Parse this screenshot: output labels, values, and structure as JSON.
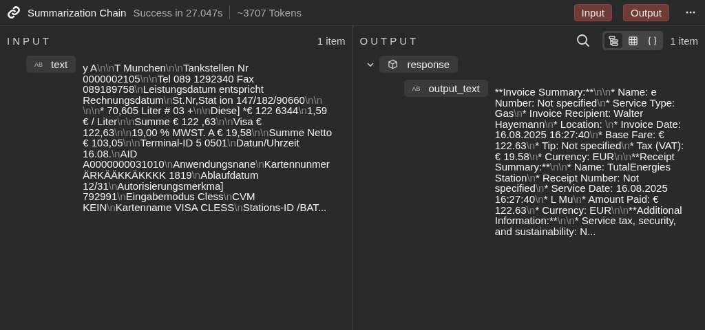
{
  "header": {
    "title": "Summarization Chain",
    "status": "Success in 27.047s",
    "tokens": "~3707 Tokens",
    "buttons": [
      {
        "label": "Input"
      },
      {
        "label": "Output"
      }
    ]
  },
  "input": {
    "title": "INPUT",
    "count": "1 item",
    "fields": [
      {
        "type_badge": "AB",
        "name": "text",
        "value": "y A\\n\\nT Munchen\\n\\nTankstellen Nr 0000002105\\n\\nTel 089 1292340 Fax 089189758\\nLeistungsdatum entspricht Rechnungsdatum\\nSt.Nr,Stat ion 147/182/90660\\n\\n \\n\\n* 70,605 Liter # 03 +\\n\\nDiese] *€ 122 6344\\n1,59 € / Liter\\n\\nSumme € 122 ,63\\n\\nVisa € 122,63\\n\\n19,00 % MWST. A € 19,58\\n\\nSumme Netto € 103,05\\n\\nTerminal-ID 5 0501\\nDatun/Uhrzeit 16.08.\\nAID A0000000031010\\nAnwendungsnane\\nKartennunmer ÄRKÄÄKKÄKKKK 1819\\nAblaufdatum 12/31\\nAutorisierungsmerkma] 792991\\nEingabemodus Cless\\nCVM KEIN\\nKartenname VISA CLESS\\nStations-ID /BAT..."
      }
    ]
  },
  "output": {
    "title": "OUTPUT",
    "count": "1 item",
    "views": [
      {
        "kind": "schema",
        "selected": true
      },
      {
        "kind": "table",
        "selected": false
      },
      {
        "kind": "json",
        "selected": false
      }
    ],
    "tree": {
      "name": "response",
      "expanded": true,
      "children": [
        {
          "type_badge": "AB",
          "name": "output_text",
          "value": "**Invoice Summary:**\\n\\n* Name: e Number: Not specified\\n* Service Type: Gas\\n* Invoice Recipient: Walter Hayemann\\n* Location: \\n* Invoice Date: 16.08.2025 16:27:40\\n* Base Fare: € 122.63\\n* Tip: Not specified\\n* Tax (VAT): € 19.58\\n* Currency: EUR\\n\\n**Receipt Summary:**\\n\\n* Name: TutalEnergies Station\\n* Receipt Number: Not specified\\n* Service Date: 16.08.2025 16:27:40\\n* L Mu\\n* Amount Paid: € 122.63\\n* Currency: EUR\\n\\n**Additional Information:**\\n\\n* Service tax, security, and sustainability: N..."
        }
      ]
    }
  }
}
